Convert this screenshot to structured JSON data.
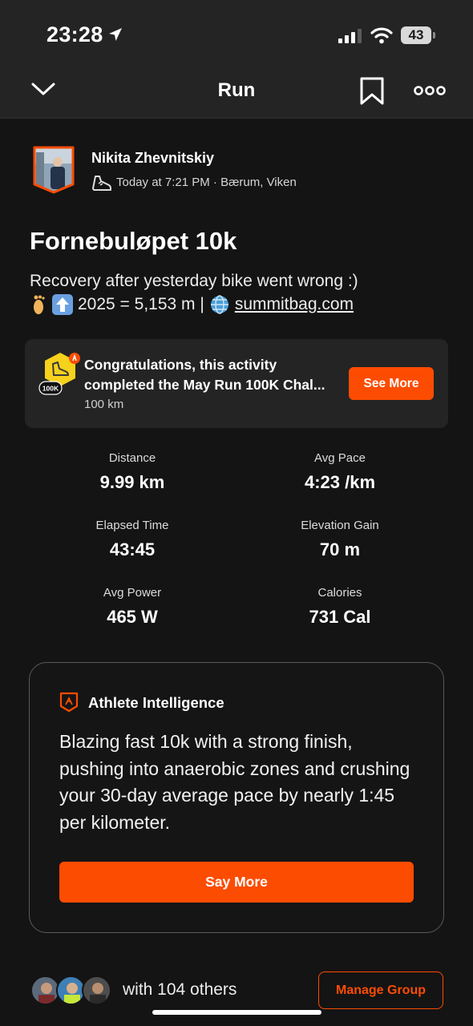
{
  "status_bar": {
    "time": "23:28",
    "battery": "43"
  },
  "nav": {
    "title": "Run"
  },
  "athlete": {
    "name": "Nikita Zhevnitskiy",
    "meta": "Today at 7:21 PM · Bærum, Viken"
  },
  "activity": {
    "title": "Fornebuløpet 10k",
    "description_line1": "Recovery after yesterday bike went wrong :)",
    "description_line2_text": "2025 = 5,153 m |",
    "description_link": "summitbag.com"
  },
  "challenge": {
    "text": "Congratulations, this activity completed the May Run 100K Chal...",
    "sub": "100 km",
    "badge_label": "100K",
    "button": "See More"
  },
  "stats": [
    {
      "label": "Distance",
      "value": "9.99 km"
    },
    {
      "label": "Avg Pace",
      "value": "4:23 /km"
    },
    {
      "label": "Elapsed Time",
      "value": "43:45"
    },
    {
      "label": "Elevation Gain",
      "value": "70 m"
    },
    {
      "label": "Avg Power",
      "value": "465 W"
    },
    {
      "label": "Calories",
      "value": "731 Cal"
    }
  ],
  "ai": {
    "title": "Athlete Intelligence",
    "body": "Blazing fast 10k with a strong finish, pushing into anaerobic zones and crushing your 30-day average pace by nearly 1:45 per kilometer.",
    "button": "Say More"
  },
  "group": {
    "text": "with 104 others",
    "button": "Manage Group"
  },
  "colors": {
    "accent": "#fc4c02",
    "background": "#141414",
    "card": "#242424"
  }
}
